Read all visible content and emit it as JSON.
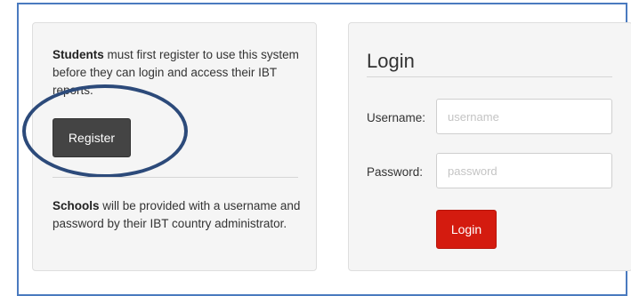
{
  "students_info": {
    "bold": "Students",
    "text": " must first register to use this system before they can login and access their IBT reports."
  },
  "register_button": "Register",
  "schools_info": {
    "bold": "Schools",
    "text": " will be provided with a username and password by their IBT country administrator."
  },
  "login": {
    "title": "Login",
    "username_label": "Username:",
    "username_placeholder": "username",
    "password_label": "Password:",
    "password_placeholder": "password",
    "button": "Login"
  },
  "colors": {
    "frame_border": "#4a7abf",
    "register_button": "#444444",
    "login_button": "#d41b0f",
    "highlight_ring": "#2c4a7a"
  }
}
